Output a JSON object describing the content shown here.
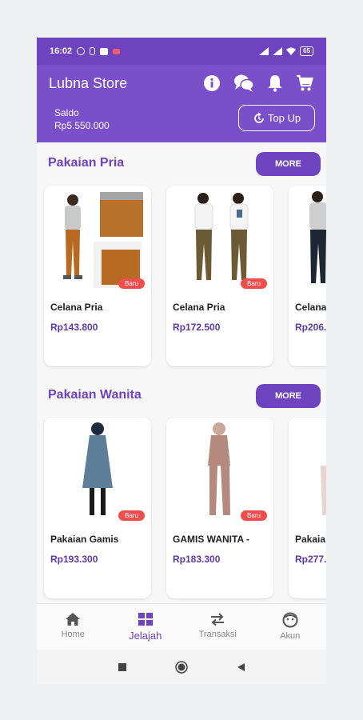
{
  "status_bar": {
    "time": "16:02",
    "battery": "65"
  },
  "header": {
    "title": "Lubna Store",
    "saldo_label": "Saldo",
    "saldo_value": "Rp5.550.000",
    "topup_label": "Top Up",
    "icons": [
      "info-icon",
      "chat-icon",
      "bell-icon",
      "cart-icon"
    ]
  },
  "sections": [
    {
      "title": "Pakaian Pria",
      "more_label": "MORE",
      "products": [
        {
          "name": "Celana Pria",
          "price": "Rp143.800",
          "badge": "Baru"
        },
        {
          "name": "Celana Pria",
          "price": "Rp172.500",
          "badge": "Baru"
        },
        {
          "name": "Celana",
          "price": "Rp206.",
          "badge": ""
        }
      ]
    },
    {
      "title": "Pakaian Wanita",
      "more_label": "MORE",
      "products": [
        {
          "name": "Pakaian Gamis",
          "price": "Rp193.300",
          "badge": "Baru"
        },
        {
          "name": "GAMIS WANITA -",
          "price": "Rp183.300",
          "badge": "Baru"
        },
        {
          "name": "Pakaia",
          "price": "Rp277.",
          "badge": ""
        }
      ]
    }
  ],
  "bottom_nav": [
    {
      "label": "Home",
      "icon": "home-icon"
    },
    {
      "label": "Jelajah",
      "icon": "grid-icon",
      "active": true
    },
    {
      "label": "Transaksi",
      "icon": "swap-icon"
    },
    {
      "label": "Akun",
      "icon": "face-icon"
    }
  ],
  "colors": {
    "primary": "#7b4fc9",
    "primary_dark": "#6f43c0",
    "badge": "#f24d4d"
  }
}
